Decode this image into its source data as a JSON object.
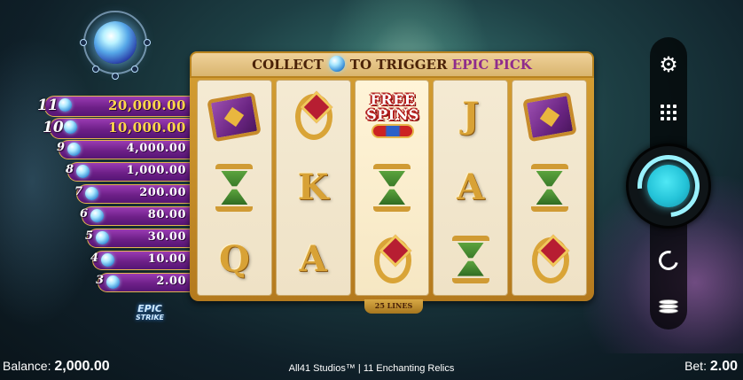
{
  "paytable": [
    {
      "count": "11",
      "amount": "20,000.00",
      "big": true
    },
    {
      "count": "10",
      "amount": "10,000.00",
      "big": true
    },
    {
      "count": "9",
      "amount": "4,000.00"
    },
    {
      "count": "8",
      "amount": "1,000.00"
    },
    {
      "count": "7",
      "amount": "200.00"
    },
    {
      "count": "6",
      "amount": "80.00"
    },
    {
      "count": "5",
      "amount": "30.00"
    },
    {
      "count": "4",
      "amount": "10.00"
    },
    {
      "count": "3",
      "amount": "2.00"
    }
  ],
  "logo": {
    "line1": "EPIC",
    "line2": "STRIKE"
  },
  "banner": {
    "part1": "COLLECT",
    "part2": "TO TRIGGER",
    "part3": "EPIC PICK"
  },
  "free_spins": {
    "line1": "FREE",
    "line2": "SPINS"
  },
  "lines_label": "25 LINES",
  "reels": [
    [
      "book",
      "hourglass",
      "Q"
    ],
    [
      "ring",
      "K",
      "A"
    ],
    [
      "free_spins",
      "hourglass",
      "ring"
    ],
    [
      "J",
      "A",
      "hourglass"
    ],
    [
      "book",
      "hourglass",
      "ring"
    ]
  ],
  "controls": {
    "settings_icon": "gear-icon",
    "menu_icon": "grid-icon",
    "spin_icon": "spin-icon",
    "autoplay_icon": "autoplay-icon",
    "bet_icon": "coins-icon"
  },
  "footer": {
    "balance_label": "Balance:",
    "balance_value": "2,000.00",
    "game_title": "All41 Studios™ | 11 Enchanting Relics",
    "bet_label": "Bet:",
    "bet_value": "2.00"
  },
  "colors": {
    "frame_gold": "#d6a034",
    "paytable_purple": "#6e2088",
    "spin_cyan": "#24c3d8"
  }
}
